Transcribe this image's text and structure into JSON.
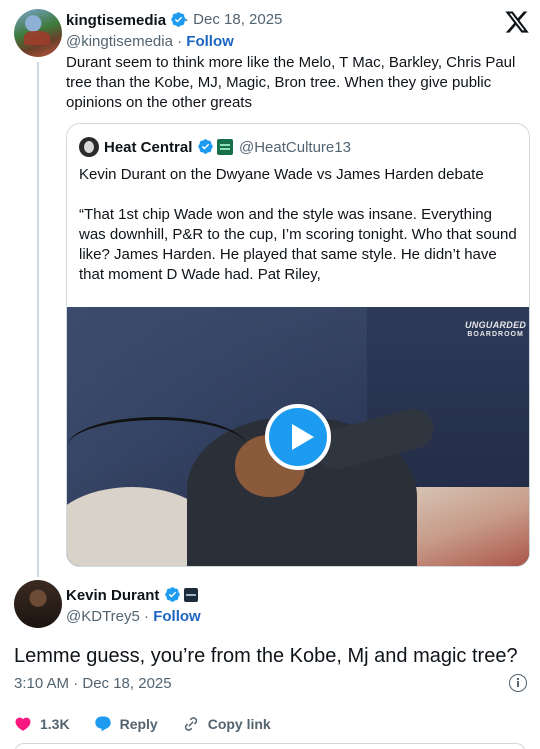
{
  "parent_tweet": {
    "author_name": "kingtisemedia",
    "handle": "@kingtisemedia",
    "separator": "·",
    "follow_label": "Follow",
    "date_text": "· Dec 18, 2025",
    "text": "Durant seem to think more like the Melo, T Mac, Barkley, Chris Paul tree than the Kobe, MJ, Magic, Bron tree. When they give public opinions on the other greats"
  },
  "quoted_tweet": {
    "author_name": "Heat Central",
    "handle": "@HeatCulture13",
    "line1": "Kevin Durant on the Dwyane Wade vs James Harden debate",
    "line2": "“That 1st chip Wade won and the style was insane. Everything was downhill, P&R to the cup, I’m scoring tonight. Who that sound like? James Harden. He played that same style. He didn’t have that moment D Wade had. Pat Riley,",
    "video_watermark_title": "UNGUARDED",
    "video_watermark_sub": "BOARDROOM"
  },
  "reply_tweet": {
    "author_name": "Kevin Durant",
    "handle": "@KDTrey5",
    "follow_label": "Follow",
    "text": "Lemme guess, you’re from the Kobe, Mj and magic tree?",
    "timestamp": "3:10 AM · Dec 18, 2025"
  },
  "actions": {
    "like_count": "1.3K",
    "reply_label": "Reply",
    "copy_label": "Copy link"
  },
  "colors": {
    "accent": "#1d9bf0",
    "follow": "#1d65c1",
    "like": "#f91880",
    "secondary_text": "#536471",
    "border": "#cfd9de"
  },
  "icons": [
    "x-logo-icon",
    "verified-badge-icon",
    "play-icon",
    "heart-icon",
    "reply-icon",
    "link-icon",
    "info-icon"
  ]
}
